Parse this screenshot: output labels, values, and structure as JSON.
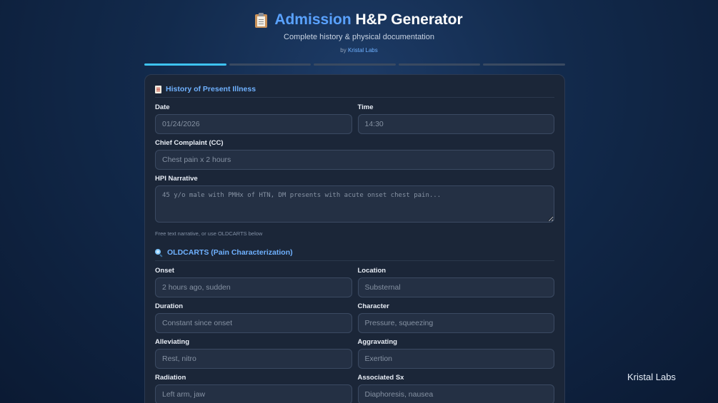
{
  "header": {
    "title_accent": "Admission",
    "title_rest": "H&P Generator",
    "subtitle": "Complete history & physical documentation",
    "by_prefix": "by",
    "by_link": "Kristal Labs"
  },
  "progress": {
    "steps_total": 5,
    "current_step": 1
  },
  "hpi_section": {
    "title": "History of Present Illness",
    "date": {
      "label": "Date",
      "placeholder": "01/24/2026"
    },
    "time": {
      "label": "Time",
      "placeholder": "14:30"
    },
    "cc": {
      "label": "Chief Complaint (CC)",
      "placeholder": "Chest pain x 2 hours"
    },
    "narrative": {
      "label": "HPI Narrative",
      "placeholder": "45 y/o male with PMHx of HTN, DM presents with acute onset chest pain..."
    },
    "hint": "Free text narrative, or use OLDCARTS below"
  },
  "oldcarts_section": {
    "title": "OLDCARTS (Pain Characterization)",
    "onset": {
      "label": "Onset",
      "placeholder": "2 hours ago, sudden"
    },
    "location": {
      "label": "Location",
      "placeholder": "Substernal"
    },
    "duration": {
      "label": "Duration",
      "placeholder": "Constant since onset"
    },
    "character": {
      "label": "Character",
      "placeholder": "Pressure, squeezing"
    },
    "alleviating": {
      "label": "Alleviating",
      "placeholder": "Rest, nitro"
    },
    "aggravating": {
      "label": "Aggravating",
      "placeholder": "Exertion"
    },
    "radiation": {
      "label": "Radiation",
      "placeholder": "Left arm, jaw"
    },
    "associated": {
      "label": "Associated Sx",
      "placeholder": "Diaphoresis, nausea"
    }
  },
  "watermark": "Kristal Labs"
}
